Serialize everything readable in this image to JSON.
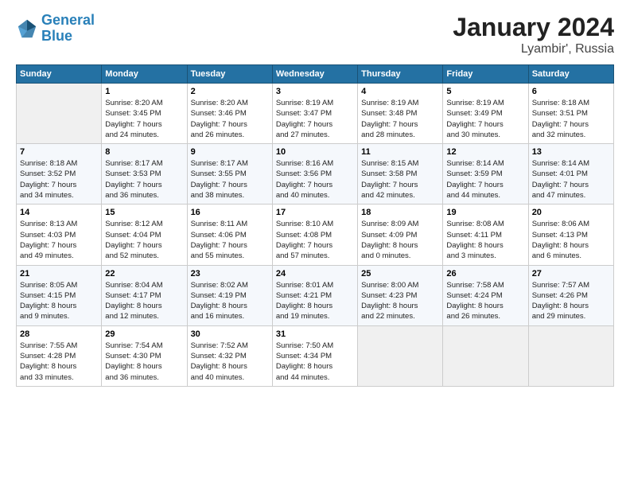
{
  "logo": {
    "line1": "General",
    "line2": "Blue"
  },
  "title": "January 2024",
  "subtitle": "Lyambir', Russia",
  "header": {
    "days": [
      "Sunday",
      "Monday",
      "Tuesday",
      "Wednesday",
      "Thursday",
      "Friday",
      "Saturday"
    ]
  },
  "weeks": [
    {
      "cells": [
        {
          "num": "",
          "content": ""
        },
        {
          "num": "1",
          "content": "Sunrise: 8:20 AM\nSunset: 3:45 PM\nDaylight: 7 hours\nand 24 minutes."
        },
        {
          "num": "2",
          "content": "Sunrise: 8:20 AM\nSunset: 3:46 PM\nDaylight: 7 hours\nand 26 minutes."
        },
        {
          "num": "3",
          "content": "Sunrise: 8:19 AM\nSunset: 3:47 PM\nDaylight: 7 hours\nand 27 minutes."
        },
        {
          "num": "4",
          "content": "Sunrise: 8:19 AM\nSunset: 3:48 PM\nDaylight: 7 hours\nand 28 minutes."
        },
        {
          "num": "5",
          "content": "Sunrise: 8:19 AM\nSunset: 3:49 PM\nDaylight: 7 hours\nand 30 minutes."
        },
        {
          "num": "6",
          "content": "Sunrise: 8:18 AM\nSunset: 3:51 PM\nDaylight: 7 hours\nand 32 minutes."
        }
      ]
    },
    {
      "cells": [
        {
          "num": "7",
          "content": "Sunrise: 8:18 AM\nSunset: 3:52 PM\nDaylight: 7 hours\nand 34 minutes."
        },
        {
          "num": "8",
          "content": "Sunrise: 8:17 AM\nSunset: 3:53 PM\nDaylight: 7 hours\nand 36 minutes."
        },
        {
          "num": "9",
          "content": "Sunrise: 8:17 AM\nSunset: 3:55 PM\nDaylight: 7 hours\nand 38 minutes."
        },
        {
          "num": "10",
          "content": "Sunrise: 8:16 AM\nSunset: 3:56 PM\nDaylight: 7 hours\nand 40 minutes."
        },
        {
          "num": "11",
          "content": "Sunrise: 8:15 AM\nSunset: 3:58 PM\nDaylight: 7 hours\nand 42 minutes."
        },
        {
          "num": "12",
          "content": "Sunrise: 8:14 AM\nSunset: 3:59 PM\nDaylight: 7 hours\nand 44 minutes."
        },
        {
          "num": "13",
          "content": "Sunrise: 8:14 AM\nSunset: 4:01 PM\nDaylight: 7 hours\nand 47 minutes."
        }
      ]
    },
    {
      "cells": [
        {
          "num": "14",
          "content": "Sunrise: 8:13 AM\nSunset: 4:03 PM\nDaylight: 7 hours\nand 49 minutes."
        },
        {
          "num": "15",
          "content": "Sunrise: 8:12 AM\nSunset: 4:04 PM\nDaylight: 7 hours\nand 52 minutes."
        },
        {
          "num": "16",
          "content": "Sunrise: 8:11 AM\nSunset: 4:06 PM\nDaylight: 7 hours\nand 55 minutes."
        },
        {
          "num": "17",
          "content": "Sunrise: 8:10 AM\nSunset: 4:08 PM\nDaylight: 7 hours\nand 57 minutes."
        },
        {
          "num": "18",
          "content": "Sunrise: 8:09 AM\nSunset: 4:09 PM\nDaylight: 8 hours\nand 0 minutes."
        },
        {
          "num": "19",
          "content": "Sunrise: 8:08 AM\nSunset: 4:11 PM\nDaylight: 8 hours\nand 3 minutes."
        },
        {
          "num": "20",
          "content": "Sunrise: 8:06 AM\nSunset: 4:13 PM\nDaylight: 8 hours\nand 6 minutes."
        }
      ]
    },
    {
      "cells": [
        {
          "num": "21",
          "content": "Sunrise: 8:05 AM\nSunset: 4:15 PM\nDaylight: 8 hours\nand 9 minutes."
        },
        {
          "num": "22",
          "content": "Sunrise: 8:04 AM\nSunset: 4:17 PM\nDaylight: 8 hours\nand 12 minutes."
        },
        {
          "num": "23",
          "content": "Sunrise: 8:02 AM\nSunset: 4:19 PM\nDaylight: 8 hours\nand 16 minutes."
        },
        {
          "num": "24",
          "content": "Sunrise: 8:01 AM\nSunset: 4:21 PM\nDaylight: 8 hours\nand 19 minutes."
        },
        {
          "num": "25",
          "content": "Sunrise: 8:00 AM\nSunset: 4:23 PM\nDaylight: 8 hours\nand 22 minutes."
        },
        {
          "num": "26",
          "content": "Sunrise: 7:58 AM\nSunset: 4:24 PM\nDaylight: 8 hours\nand 26 minutes."
        },
        {
          "num": "27",
          "content": "Sunrise: 7:57 AM\nSunset: 4:26 PM\nDaylight: 8 hours\nand 29 minutes."
        }
      ]
    },
    {
      "cells": [
        {
          "num": "28",
          "content": "Sunrise: 7:55 AM\nSunset: 4:28 PM\nDaylight: 8 hours\nand 33 minutes."
        },
        {
          "num": "29",
          "content": "Sunrise: 7:54 AM\nSunset: 4:30 PM\nDaylight: 8 hours\nand 36 minutes."
        },
        {
          "num": "30",
          "content": "Sunrise: 7:52 AM\nSunset: 4:32 PM\nDaylight: 8 hours\nand 40 minutes."
        },
        {
          "num": "31",
          "content": "Sunrise: 7:50 AM\nSunset: 4:34 PM\nDaylight: 8 hours\nand 44 minutes."
        },
        {
          "num": "",
          "content": ""
        },
        {
          "num": "",
          "content": ""
        },
        {
          "num": "",
          "content": ""
        }
      ]
    }
  ]
}
